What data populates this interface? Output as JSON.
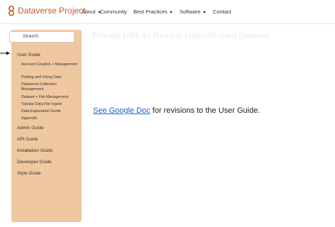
{
  "brand": {
    "name": "Dataverse Project"
  },
  "nav": {
    "items": [
      {
        "label": "About",
        "dropdown": true
      },
      {
        "label": "Community",
        "dropdown": false
      },
      {
        "label": "Best Practices",
        "dropdown": true
      },
      {
        "label": "Software",
        "dropdown": true
      },
      {
        "label": "Contact",
        "dropdown": false
      }
    ]
  },
  "sidebar": {
    "search_placeholder": "Search",
    "user_guide": "User Guide",
    "sub_items": [
      "Account Creation + Management",
      "Finding and Using Data",
      "Dataverse Collection Management",
      "Dataset + File Management",
      "Tabular Data File Ingest",
      "Data Exploration Guide",
      "Appendix"
    ],
    "guides": [
      "Admin Guide",
      "API Guide",
      "Installation Guide",
      "Developer Guide",
      "Style Guide"
    ]
  },
  "main": {
    "title": "Private URL to Review Unpublished Dataset"
  },
  "overlay": {
    "link_text": "See Google Doc",
    "rest_text": " for revisions to the User Guide."
  },
  "colors": {
    "brand": "#c55b28",
    "sidebar_bg": "#f0c8a0",
    "link": "#1a63c6"
  }
}
